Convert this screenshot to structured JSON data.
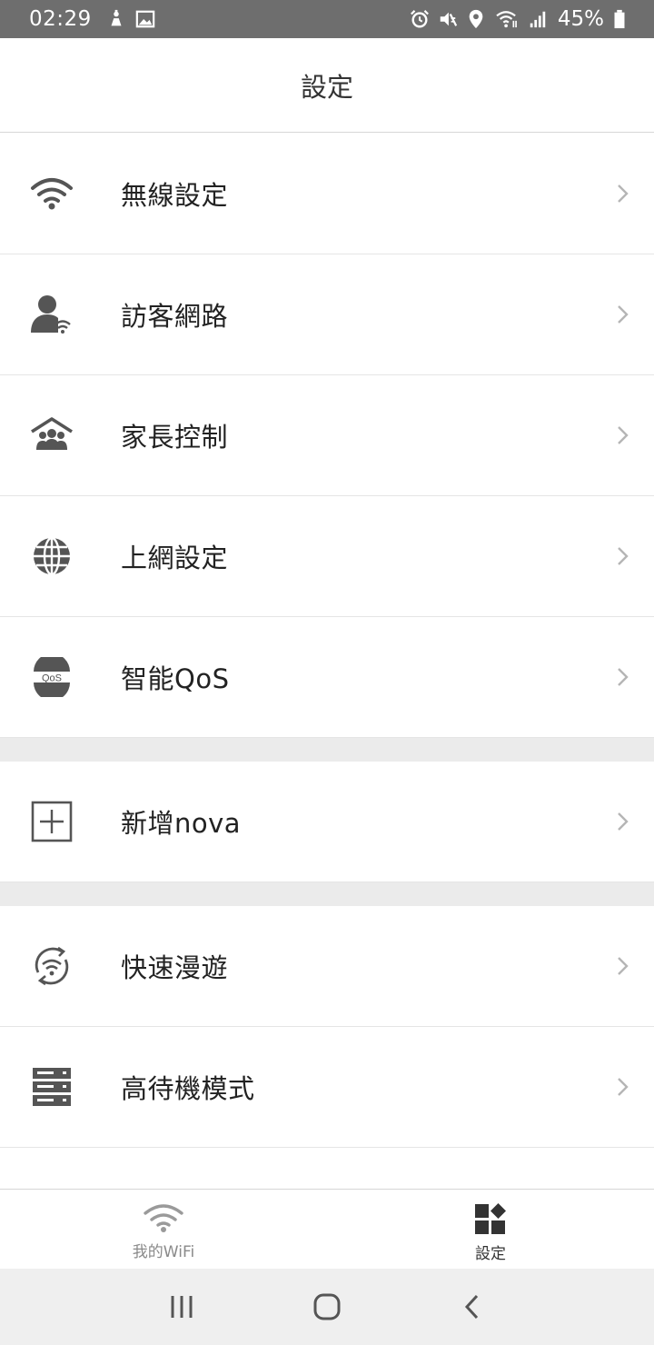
{
  "status_bar": {
    "time": "02:29",
    "battery": "45%",
    "left_icons": [
      "android-debug-icon",
      "image-icon"
    ],
    "right_icons": [
      "alarm-icon",
      "mute-icon",
      "location-icon",
      "wifi-icon",
      "signal-icon",
      "battery-icon"
    ]
  },
  "header": {
    "title": "設定"
  },
  "settings": {
    "items": [
      {
        "label": "無線設定",
        "icon": "wifi-icon"
      },
      {
        "label": "訪客網路",
        "icon": "guest-user-icon"
      },
      {
        "label": "家長控制",
        "icon": "parental-control-icon"
      },
      {
        "label": "上網設定",
        "icon": "globe-icon"
      },
      {
        "label": "智能QoS",
        "icon": "qos-icon"
      },
      {
        "label": "新增nova",
        "icon": "add-square-icon"
      },
      {
        "label": "快速漫遊",
        "icon": "fast-roaming-icon"
      },
      {
        "label": "高待機模式",
        "icon": "server-icon"
      }
    ],
    "qos_badge": "QoS"
  },
  "bottom_nav": {
    "tabs": [
      {
        "label": "我的WiFi",
        "icon": "wifi-icon",
        "active": false
      },
      {
        "label": "設定",
        "icon": "settings-grid-icon",
        "active": true
      }
    ]
  },
  "colors": {
    "status_bar_bg": "#6e6e6e",
    "icon_gray": "#555555",
    "chevron": "#b5b5b5",
    "section_gap": "#ebebeb",
    "inactive_tab": "#8a8a8a",
    "active_tab": "#333333"
  }
}
